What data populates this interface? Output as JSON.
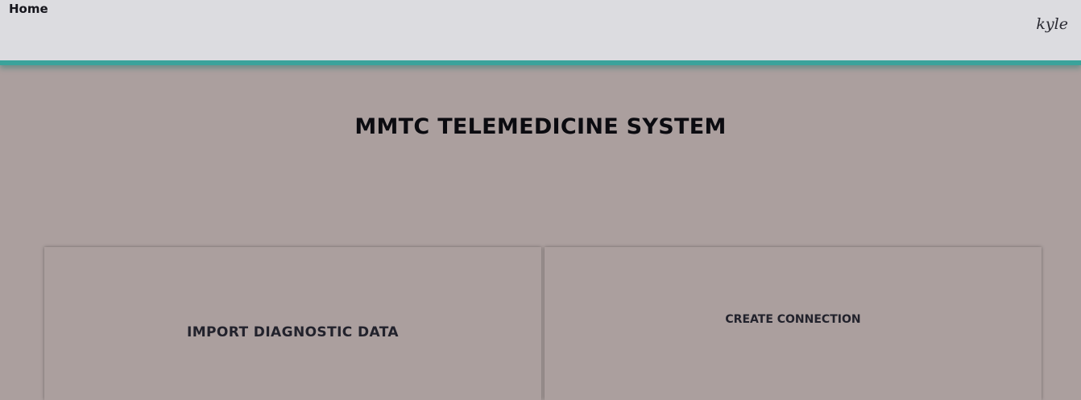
{
  "nav": {
    "home_label": "Home",
    "user_name": "kyle"
  },
  "main": {
    "title": "MMTC TELEMEDICINE SYSTEM",
    "cards": [
      {
        "label": "IMPORT DIAGNOSTIC DATA"
      },
      {
        "label": "CREATE CONNECTION"
      }
    ]
  },
  "colors": {
    "page_background": "#ab9f9e",
    "topbar_background": "#dcdce0",
    "accent_teal": "#3aa39b",
    "text_dark": "#0b0b10"
  }
}
